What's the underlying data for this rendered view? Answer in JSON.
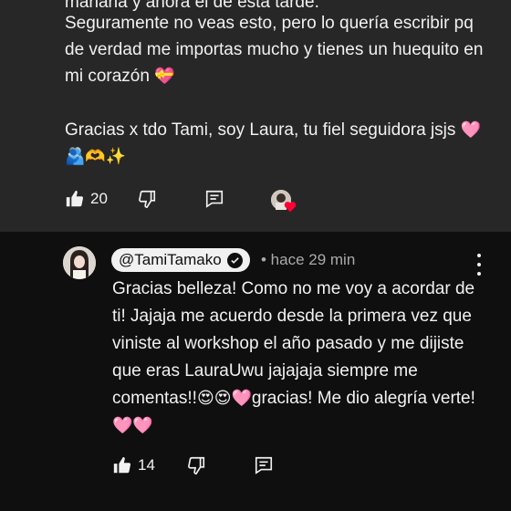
{
  "top_comment": {
    "cut_line": "mañana y ahora el de esta tarde.",
    "paragraph1": "Seguramente no veas esto, pero lo quería escribir pq de verdad me importas mucho y tienes un huequito en mi corazón",
    "paragraph1_emoji": "💝",
    "paragraph2": "Gracias x tdo Tami, soy Laura, tu fiel seguidora jsjs",
    "paragraph2_emoji": "🩷🫂🫶✨",
    "like_count": "20"
  },
  "reply": {
    "handle": "@TamiTamako",
    "meta": "• hace 29 min",
    "text_main": "Gracias belleza! Como no me voy a acordar de ti! Jajaja me acuerdo desde la primera vez que viniste al workshop el año pasado y me dijiste que eras LauraUwu jajajaja siempre me comentas!!",
    "emoji_mid": "😍😍🩷",
    "text_end": "gracias! Me dio alegría verte!",
    "emoji_end": "🩷🩷",
    "like_count": "14"
  },
  "icons": [
    "thumbs-up-icon",
    "thumbs-down-icon",
    "reply-icon",
    "creator-heart-icon",
    "verified-check-icon",
    "more-vert-icon"
  ],
  "colors": {
    "top_bg": "#272727",
    "reply_bg": "#0f0f0f",
    "heart": "#ff0033",
    "meta": "#aaaaaa"
  }
}
